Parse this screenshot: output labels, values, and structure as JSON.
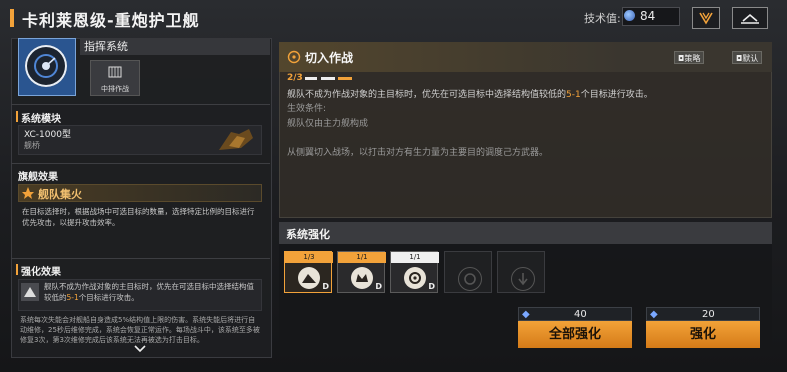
{
  "header": {
    "title": "卡利莱恩级-重炮护卫舰",
    "tech_label": "技术值:",
    "tech_value": "84"
  },
  "left": {
    "command": {
      "title": "指挥系统",
      "chip_label": "中排作战"
    },
    "module": {
      "heading": "系统模块",
      "name": "XC-1000型",
      "sub": "舰桥"
    },
    "flagship": {
      "heading": "旗舰效果",
      "name": "舰队集火",
      "desc": "在目标选择时，根据战场中可选目标的数量，选择特定比例的目标进行优先攻击，以提升攻击效率。"
    },
    "enhance": {
      "heading": "强化效果",
      "desc_part1": "舰队不成为作战对象的主目标时，优先在可选目标中选择结构值较低的",
      "desc_hl": "5-1",
      "desc_part2": "个目标进行攻击。",
      "more": "系统每次失能会对舰船自身造成5%结构值上限的伤害。系统失能后将进行自动维修，25秒后维修完成，系统会恢复正常运作。每场战斗中，该系统至多被修复3次，第3次维修完成后该系统无法再被选为打击目标。"
    }
  },
  "detail": {
    "title": "切入作战",
    "tag_strategy": "策略",
    "tag_default": "默认",
    "progress": "2/3",
    "progress_level": 2,
    "progress_max": 3,
    "line1_a": "舰队不成为作战对象的主目标时，优先在可选目标中选择结构值较低的",
    "line1_hl": "5-1",
    "line1_b": "个目标进行攻击。",
    "cond_label": "生效条件:",
    "cond_text": "舰队仅由主力舰构成",
    "flavor": "从侧翼切入战场，以打击对方有生力量为主要目的调度己方武器。"
  },
  "enhance_panel": {
    "title": "系统强化",
    "tiles": [
      {
        "count": "1/3",
        "badge": "D",
        "state": "selected"
      },
      {
        "count": "1/1",
        "badge": "D",
        "state": "done"
      },
      {
        "count": "1/1",
        "badge": "D",
        "state": "white"
      },
      {
        "count": "",
        "badge": "",
        "state": "locked"
      },
      {
        "count": "",
        "badge": "",
        "state": "locked"
      }
    ],
    "all_cost": "40",
    "all_label": "全部强化",
    "one_cost": "20",
    "one_label": "强化"
  },
  "colors": {
    "accent": "#f2a23a",
    "highlight": "#f2a23a"
  }
}
